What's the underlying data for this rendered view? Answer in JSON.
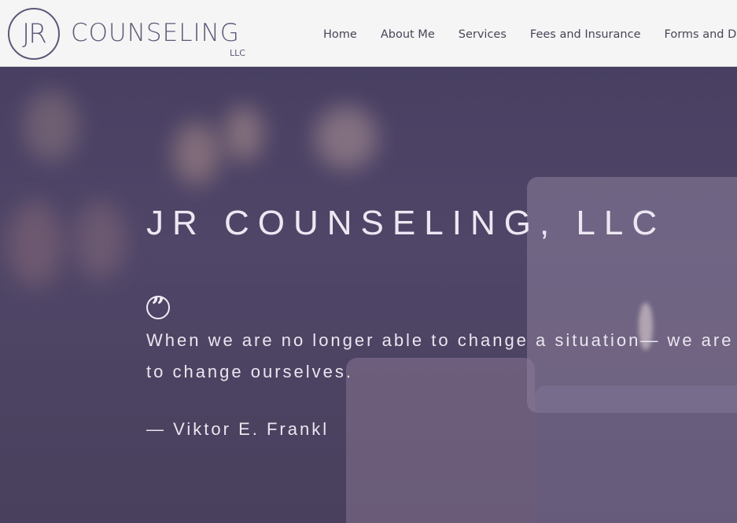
{
  "logo": {
    "monogram": "JR",
    "name": "COUNSELING",
    "suffix": "LLC"
  },
  "nav": {
    "items": [
      "Home",
      "About Me",
      "Services",
      "Fees and Insurance",
      "Forms and Doc"
    ]
  },
  "hero": {
    "title": "JR COUNSELING, LLC",
    "quote_line1": "When we are no longer able to change a situation— we are",
    "quote_line2": "to change ourselves.",
    "author": "— Viktor E. Frankl"
  },
  "colors": {
    "brand": "#5e5878",
    "header_bg": "#f5f5f5",
    "hero_overlay": "#4b4361"
  },
  "icons": {
    "quote": "quote-icon"
  }
}
